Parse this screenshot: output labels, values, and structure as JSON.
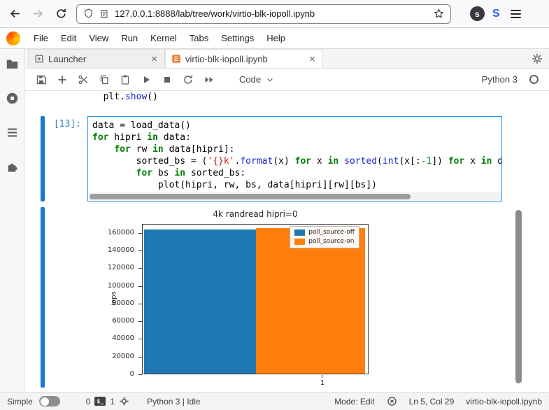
{
  "browser": {
    "url": "127.0.0.1:8888/lab/tree/work/virtio-blk-iopoll.ipynb",
    "badge_dark": "s",
    "badge_blue": "S"
  },
  "menubar": {
    "items": [
      "File",
      "Edit",
      "View",
      "Run",
      "Kernel",
      "Tabs",
      "Settings",
      "Help"
    ]
  },
  "tabbar": {
    "tabs": [
      {
        "label": "Launcher",
        "active": false
      },
      {
        "label": "virtio-blk-iopoll.ipynb",
        "active": true
      }
    ]
  },
  "toolbar": {
    "cell_type": "Code",
    "kernel_name": "Python 3"
  },
  "notebook": {
    "partial_line": [
      {
        "t": "  plt."
      },
      {
        "t": "show",
        "c": "fn"
      },
      {
        "t": "()"
      }
    ],
    "cell": {
      "prompt": "[13]:",
      "lines": [
        [
          {
            "t": "data = load_data()"
          }
        ],
        [
          {
            "t": "for",
            "c": "kw"
          },
          {
            "t": " hipri "
          },
          {
            "t": "in",
            "c": "kw"
          },
          {
            "t": " data:"
          }
        ],
        [
          {
            "t": "    "
          },
          {
            "t": "for",
            "c": "kw"
          },
          {
            "t": " rw "
          },
          {
            "t": "in",
            "c": "kw"
          },
          {
            "t": " data[hipri]:"
          }
        ],
        [
          {
            "t": "        sorted_bs = ("
          },
          {
            "t": "'{}k'",
            "c": "str"
          },
          {
            "t": "."
          },
          {
            "t": "format",
            "c": "fn"
          },
          {
            "t": "(x) "
          },
          {
            "t": "for",
            "c": "kw"
          },
          {
            "t": " x "
          },
          {
            "t": "in",
            "c": "kw"
          },
          {
            "t": " "
          },
          {
            "t": "sorted",
            "c": "fn"
          },
          {
            "t": "("
          },
          {
            "t": "int",
            "c": "fn"
          },
          {
            "t": "(x[:"
          },
          {
            "t": "-1",
            "c": "num"
          },
          {
            "t": "]) "
          },
          {
            "t": "for",
            "c": "kw"
          },
          {
            "t": " x "
          },
          {
            "t": "in",
            "c": "kw"
          },
          {
            "t": " d"
          }
        ],
        [
          {
            "t": "        "
          },
          {
            "t": "for",
            "c": "kw"
          },
          {
            "t": " bs "
          },
          {
            "t": "in",
            "c": "kw"
          },
          {
            "t": " sorted_bs:"
          }
        ],
        [
          {
            "t": "            plot(hipri, rw, bs, data[hipri][rw][bs])"
          }
        ]
      ]
    }
  },
  "chart_data": {
    "type": "bar",
    "title": "4k randread hipri=0",
    "xlabel": "",
    "ylabel": "iops",
    "categories": [
      "1"
    ],
    "series": [
      {
        "name": "poll_source-off",
        "color": "#1f77b4",
        "values": [
          163000
        ]
      },
      {
        "name": "poll_source-on",
        "color": "#ff7f0e",
        "values": [
          164500
        ]
      }
    ],
    "yticks": [
      0,
      20000,
      40000,
      60000,
      80000,
      100000,
      120000,
      140000,
      160000
    ],
    "ylim": [
      0,
      170000
    ],
    "legend_position": "upper right",
    "grid": false
  },
  "statusbar": {
    "simple_label": "Simple",
    "terminals_count": "0",
    "kernels_count": "1",
    "kernel_status": "Python 3 | Idle",
    "mode": "Mode: Edit",
    "cursor_position": "Ln 5, Col 29",
    "filename": "virtio-blk-iopoll.ipynb"
  },
  "colors": {
    "accent": "#1976d2",
    "active_cell_border": "#2196f3",
    "bar_blue": "#1f77b4",
    "bar_orange": "#ff7f0e"
  }
}
